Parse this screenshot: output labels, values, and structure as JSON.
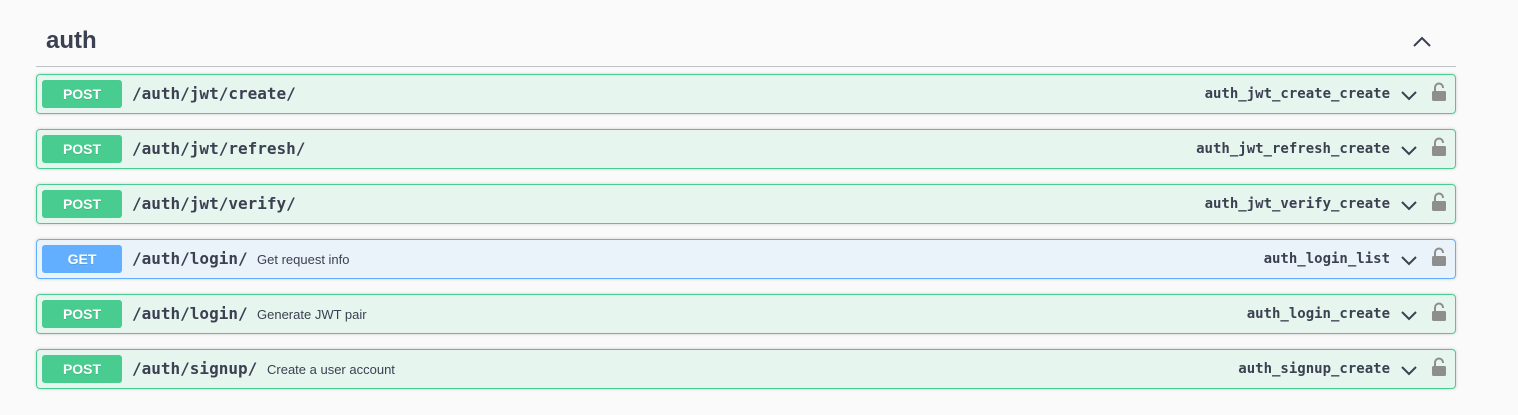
{
  "section": {
    "title": "auth"
  },
  "operations": [
    {
      "method": "POST",
      "path": "/auth/jwt/create/",
      "summary": "",
      "operation_id": "auth_jwt_create_create"
    },
    {
      "method": "POST",
      "path": "/auth/jwt/refresh/",
      "summary": "",
      "operation_id": "auth_jwt_refresh_create"
    },
    {
      "method": "POST",
      "path": "/auth/jwt/verify/",
      "summary": "",
      "operation_id": "auth_jwt_verify_create"
    },
    {
      "method": "GET",
      "path": "/auth/login/",
      "summary": "Get request info",
      "operation_id": "auth_login_list"
    },
    {
      "method": "POST",
      "path": "/auth/login/",
      "summary": "Generate JWT pair",
      "operation_id": "auth_login_create"
    },
    {
      "method": "POST",
      "path": "/auth/signup/",
      "summary": "Create a user account",
      "operation_id": "auth_signup_create"
    }
  ],
  "colors": {
    "post": "#49cc90",
    "get": "#61affe",
    "text": "#3b4151"
  },
  "icons": {
    "collapse": "chevron-up-icon",
    "expand": "chevron-down-icon",
    "lock": "unlocked-icon"
  }
}
